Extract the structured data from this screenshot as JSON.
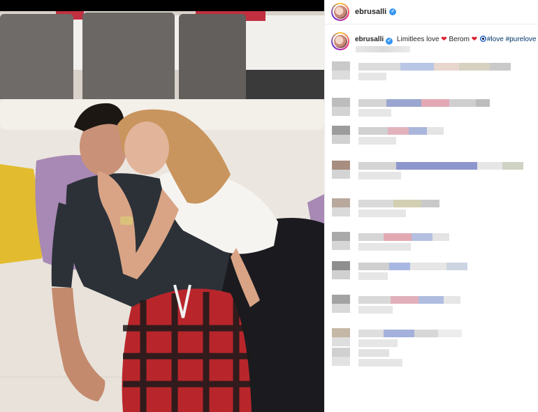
{
  "post": {
    "username": "ebrusalli",
    "verified_label": "✓",
    "caption": {
      "username": "ebrusalli",
      "text_1": "Limitlees love",
      "text_2": "Berom",
      "hashtag_1": "#love",
      "hashtag_2": "#purelove"
    }
  },
  "comments_blurred": true,
  "colors": {
    "verified_blue": "#3897f0",
    "hashtag": "#003569",
    "heart": "#d9212f"
  },
  "icons": [
    "verified-badge-icon",
    "heart-emoji-icon",
    "evil-eye-emoji-icon"
  ]
}
